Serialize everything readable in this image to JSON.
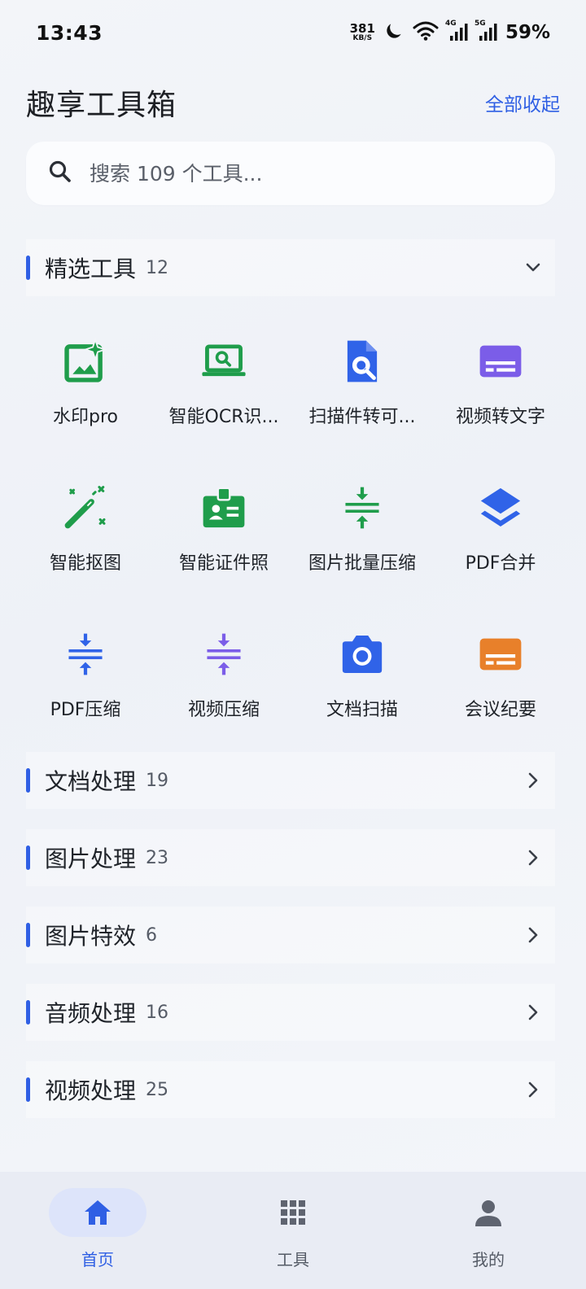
{
  "status": {
    "time": "13:43",
    "net_speed": "381",
    "net_unit": "KB/S",
    "sig1_tag": "4G",
    "sig2_tag": "5G",
    "battery": "59%"
  },
  "header": {
    "title": "趣享工具箱",
    "collapse_all": "全部收起"
  },
  "search": {
    "placeholder": "搜索 109 个工具..."
  },
  "featured": {
    "name": "精选工具",
    "count": "12",
    "tools": [
      {
        "label": "水印pro",
        "icon": "sparkle-image-icon",
        "color": "#1f9d4b"
      },
      {
        "label": "智能OCR识...",
        "icon": "laptop-search-icon",
        "color": "#1f9d4b"
      },
      {
        "label": "扫描件转可...",
        "icon": "document-search-icon",
        "color": "#3063e8"
      },
      {
        "label": "视频转文字",
        "icon": "subtitles-icon",
        "color": "#7b5de8"
      },
      {
        "label": "智能抠图",
        "icon": "magic-wand-icon",
        "color": "#1f9d4b"
      },
      {
        "label": "智能证件照",
        "icon": "id-badge-icon",
        "color": "#1f9d4b"
      },
      {
        "label": "图片批量压缩",
        "icon": "compress-icon",
        "color": "#1f9d4b"
      },
      {
        "label": "PDF合并",
        "icon": "layers-icon",
        "color": "#3063e8"
      },
      {
        "label": "PDF压缩",
        "icon": "compress-icon",
        "color": "#3063e8"
      },
      {
        "label": "视频压缩",
        "icon": "compress-icon",
        "color": "#7b5de8"
      },
      {
        "label": "文档扫描",
        "icon": "camera-icon",
        "color": "#3063e8"
      },
      {
        "label": "会议纪要",
        "icon": "subtitles-icon",
        "color": "#e8802a"
      }
    ]
  },
  "categories": [
    {
      "name": "文档处理",
      "count": "19"
    },
    {
      "name": "图片处理",
      "count": "23"
    },
    {
      "name": "图片特效",
      "count": "6"
    },
    {
      "name": "音频处理",
      "count": "16"
    },
    {
      "name": "视频处理",
      "count": "25"
    }
  ],
  "nav": {
    "home": "首页",
    "tools": "工具",
    "mine": "我的"
  },
  "colors": {
    "accent": "#2f5fe4"
  }
}
